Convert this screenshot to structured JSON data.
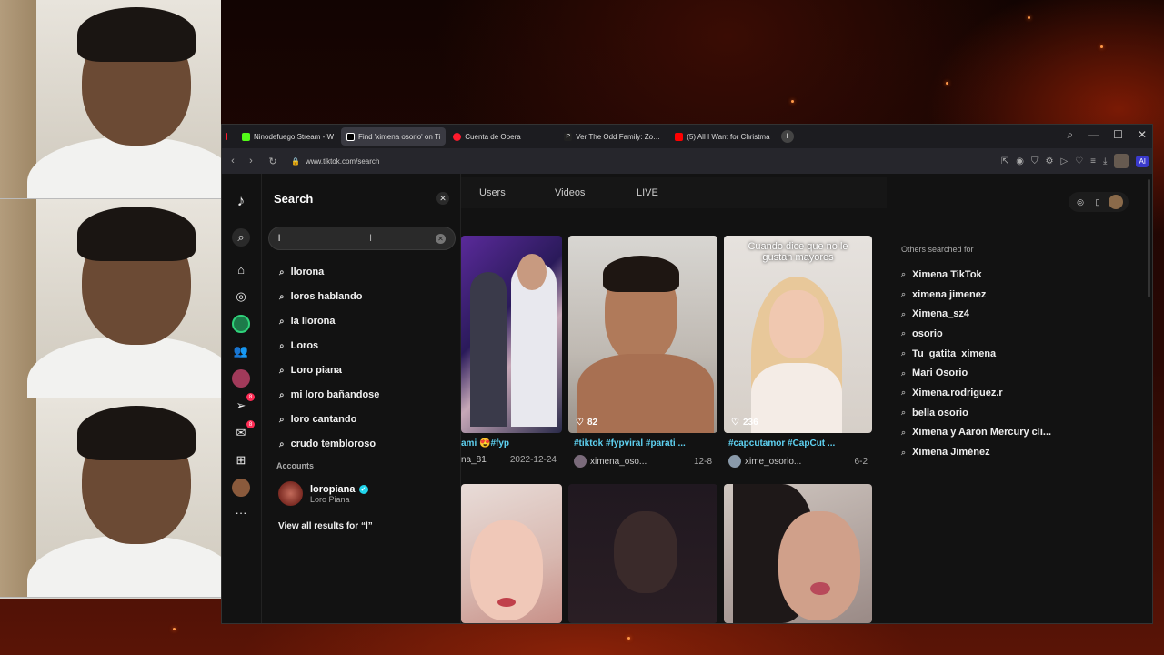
{
  "browser": {
    "tabs": [
      {
        "label": "Ninodefuego Stream - W",
        "favicon_color": "#53fc18"
      },
      {
        "label": "Find 'ximena osorio' on Ti",
        "favicon_color": "#ffffff",
        "active": true
      },
      {
        "label": "Cuenta de Opera",
        "favicon_color": "#ff1b2d"
      },
      {
        "label": "Ver The Odd Family: Zomb",
        "favicon_color": "#ffffff"
      },
      {
        "label": "(5) All I Want for Christma",
        "favicon_color": "#ff0000"
      }
    ],
    "new_tab_symbol": "+",
    "url": "www.tiktok.com/search",
    "ai_label": "AI"
  },
  "rail": {
    "badge_inbox": "8",
    "badge_messages": "8"
  },
  "search_panel": {
    "title": "Search",
    "input_value": "l",
    "suggestions": [
      "llorona",
      "loros hablando",
      "la llorona",
      "Loros",
      "Loro piana",
      "mi loro bañandose",
      "loro cantando",
      "crudo tembloroso"
    ],
    "accounts_heading": "Accounts",
    "account": {
      "name": "loropiana",
      "subtitle": "Loro Piana"
    },
    "view_all": "View all results for “l”"
  },
  "tabs": [
    "Users",
    "Videos",
    "LIVE"
  ],
  "videos": [
    {
      "caption": "ami 😍#fyp",
      "user": "na_81",
      "date": "2022-12-24",
      "likes": ""
    },
    {
      "caption": "#tiktok #fypviral #parati ...",
      "user": "ximena_oso...",
      "date": "12-8",
      "likes": "82"
    },
    {
      "caption": "#capcutamor #CapCut ...",
      "user": "xime_osorio...",
      "date": "6-2",
      "likes": "236",
      "overlay": "Cuando dice que no le gustan mayores"
    }
  ],
  "others": {
    "title": "Others searched for",
    "items": [
      "Ximena TikTok",
      "ximena jimenez",
      "Ximena_sz4",
      "osorio",
      "Tu_gatita_ximena",
      "Mari Osorio",
      "Ximena.rodriguez.r",
      "bella osorio",
      "Ximena y Aarón Mercury cli...",
      "Ximena Jiménez"
    ]
  }
}
